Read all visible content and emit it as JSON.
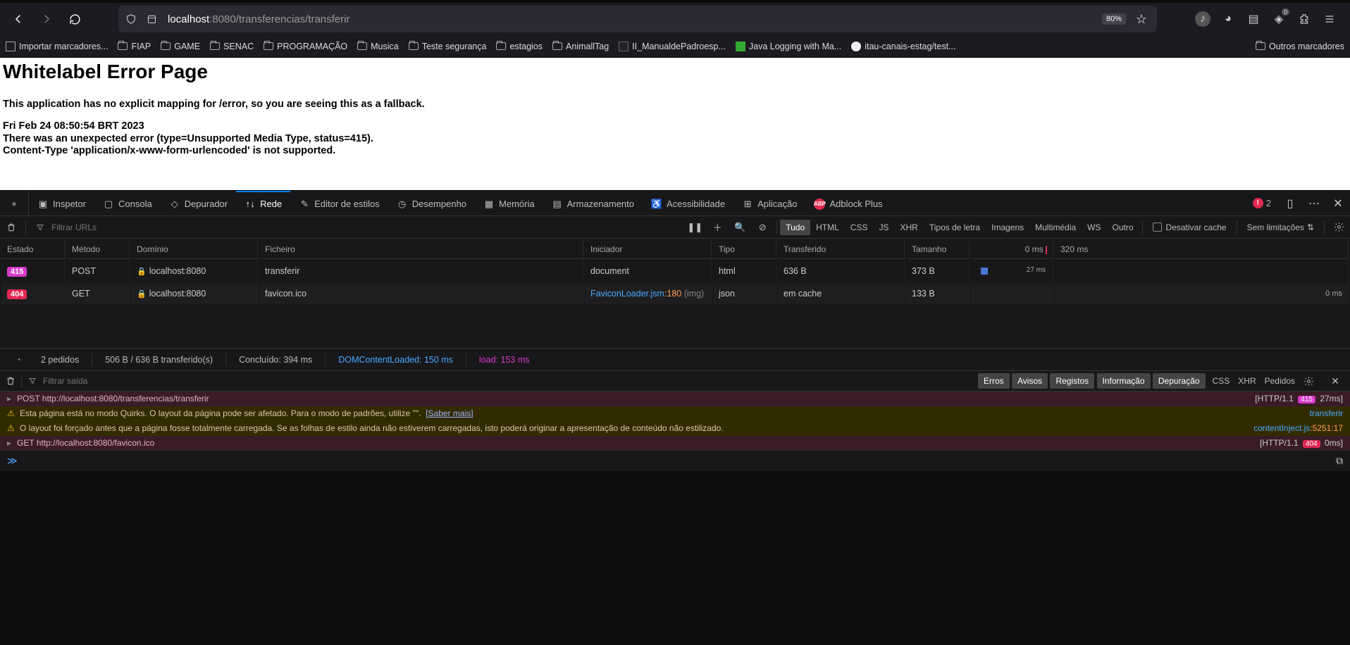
{
  "toolbar": {
    "url_host": "localhost",
    "url_port": ":8080",
    "url_path": "/transferencias/transferir",
    "zoom": "80%"
  },
  "ext_badge": "0",
  "bookmarks": {
    "import": "Importar marcadores...",
    "items": [
      "FIAP",
      "GAME",
      "SENAC",
      "PROGRAMAÇÃO",
      "Musica",
      "Teste segurança",
      "estagios",
      "AnimallTag"
    ],
    "manual": "II_ManualdePadroesp...",
    "java": "Java Logging with Ma...",
    "itau": "itau-canais-estag/test...",
    "other": "Outros marcadores"
  },
  "page": {
    "title": "Whitelabel Error Page",
    "l1": "This application has no explicit mapping for /error, so you are seeing this as a fallback.",
    "l2": "Fri Feb 24 08:50:54 BRT 2023",
    "l3": "There was an unexpected error (type=Unsupported Media Type, status=415).",
    "l4": "Content-Type 'application/x-www-form-urlencoded' is not supported."
  },
  "devtools": {
    "tabs": {
      "inspector": "Inspetor",
      "console": "Consola",
      "debugger": "Depurador",
      "network": "Rede",
      "style": "Editor de estilos",
      "perf": "Desempenho",
      "memory": "Memória",
      "storage": "Armazenamento",
      "a11y": "Acessibilidade",
      "app": "Aplicação",
      "adblock": "Adblock Plus"
    },
    "error_count": "2"
  },
  "netbar": {
    "filter_ph": "Filtrar URLs",
    "pills": {
      "all": "Tudo",
      "html": "HTML",
      "css": "CSS",
      "js": "JS",
      "xhr": "XHR",
      "fonts": "Tipos de letra",
      "img": "Imagens",
      "media": "Multimédia",
      "ws": "WS",
      "other": "Outro"
    },
    "cache": "Desativar cache",
    "throttle": "Sem limitações"
  },
  "net_headers": {
    "status": "Estado",
    "method": "Método",
    "domain": "Domínio",
    "file": "Ficheiro",
    "initiator": "Iniciador",
    "type": "Tipo",
    "transferred": "Transferido",
    "size": "Tamanho",
    "t0": "0 ms",
    "t1": "320 ms"
  },
  "net_rows": [
    {
      "status": "415",
      "scls": "s415",
      "method": "POST",
      "domain": "localhost:8080",
      "file": "transferir",
      "initiator": "document",
      "init_link": "",
      "init_line": "",
      "init_suffix": "",
      "type": "html",
      "transferred": "636 B",
      "size": "373 B",
      "timing": "27 ms",
      "bar_left": "6",
      "bar_w": "10"
    },
    {
      "status": "404",
      "scls": "s404",
      "method": "GET",
      "domain": "localhost:8080",
      "file": "favicon.ico",
      "initiator": "",
      "init_link": "FaviconLoader.jsm",
      "init_line": ":180",
      "init_suffix": " (img)",
      "type": "json",
      "transferred": "em cache",
      "size": "133 B",
      "timing": "0 ms",
      "bar_left": "",
      "bar_w": ""
    }
  ],
  "net_footer": {
    "requests": "2 pedidos",
    "transferred": "506 B / 636 B transferido(s)",
    "finish": "Concluído: 394 ms",
    "dcl": "DOMContentLoaded: 150 ms",
    "load": "load: 153 ms"
  },
  "conbar": {
    "filter_ph": "Filtrar saída",
    "pills": {
      "errors": "Erros",
      "warnings": "Avisos",
      "logs": "Registos",
      "info": "Informação",
      "debug": "Depuração"
    },
    "right": {
      "css": "CSS",
      "xhr": "XHR",
      "requests": "Pedidos"
    }
  },
  "console": [
    {
      "kind": "net",
      "arrow": "▸",
      "text": "POST http://localhost:8080/transferencias/transferir",
      "proto": "[HTTP/1.1 ",
      "pill": "415",
      "pcls": "s415",
      "time": "27ms]"
    },
    {
      "kind": "warn",
      "text": "Esta página está no modo Quirks. O layout da página pode ser afetado. Para o modo de padrões, utilize \"<!DOCTYPE html>\". ",
      "saber": "[Saber mais]",
      "src": "transferir"
    },
    {
      "kind": "warn",
      "text": "O layout foi forçado antes que a página fosse totalmente carregada. Se as folhas de estilo ainda não estiverem carregadas, isto poderá originar a apresentação de conteúdo não estilizado.",
      "src": "contentInject.js",
      "srcline": ":5251:17"
    },
    {
      "kind": "net",
      "arrow": "▸",
      "text": "GET http://localhost:8080/favicon.ico",
      "proto": "[HTTP/1.1 ",
      "pill": "404",
      "pcls": "s404",
      "time": "0ms]"
    }
  ]
}
